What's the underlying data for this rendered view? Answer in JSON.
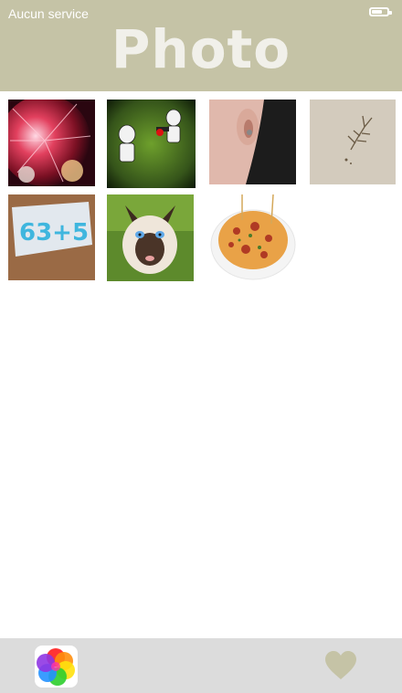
{
  "status": {
    "carrier": "Aucun service",
    "battery_level": 0.5
  },
  "header": {
    "title": "Photo"
  },
  "gallery": {
    "items": [
      {
        "subject": "fireworks"
      },
      {
        "subject": "stormtroopers"
      },
      {
        "subject": "ear"
      },
      {
        "subject": "insect"
      },
      {
        "subject": "paper-63-5"
      },
      {
        "subject": "siamese-cat"
      },
      {
        "subject": "pasta"
      }
    ],
    "paper_text": "63+5"
  },
  "bottom_bar": {
    "left_icon": "color-wheel-icon",
    "right_icon": "heart-icon",
    "heart_color": "#c5c3a6"
  },
  "colors": {
    "header": "#c5c3a6",
    "bottom_bar": "#dcdcdc"
  }
}
